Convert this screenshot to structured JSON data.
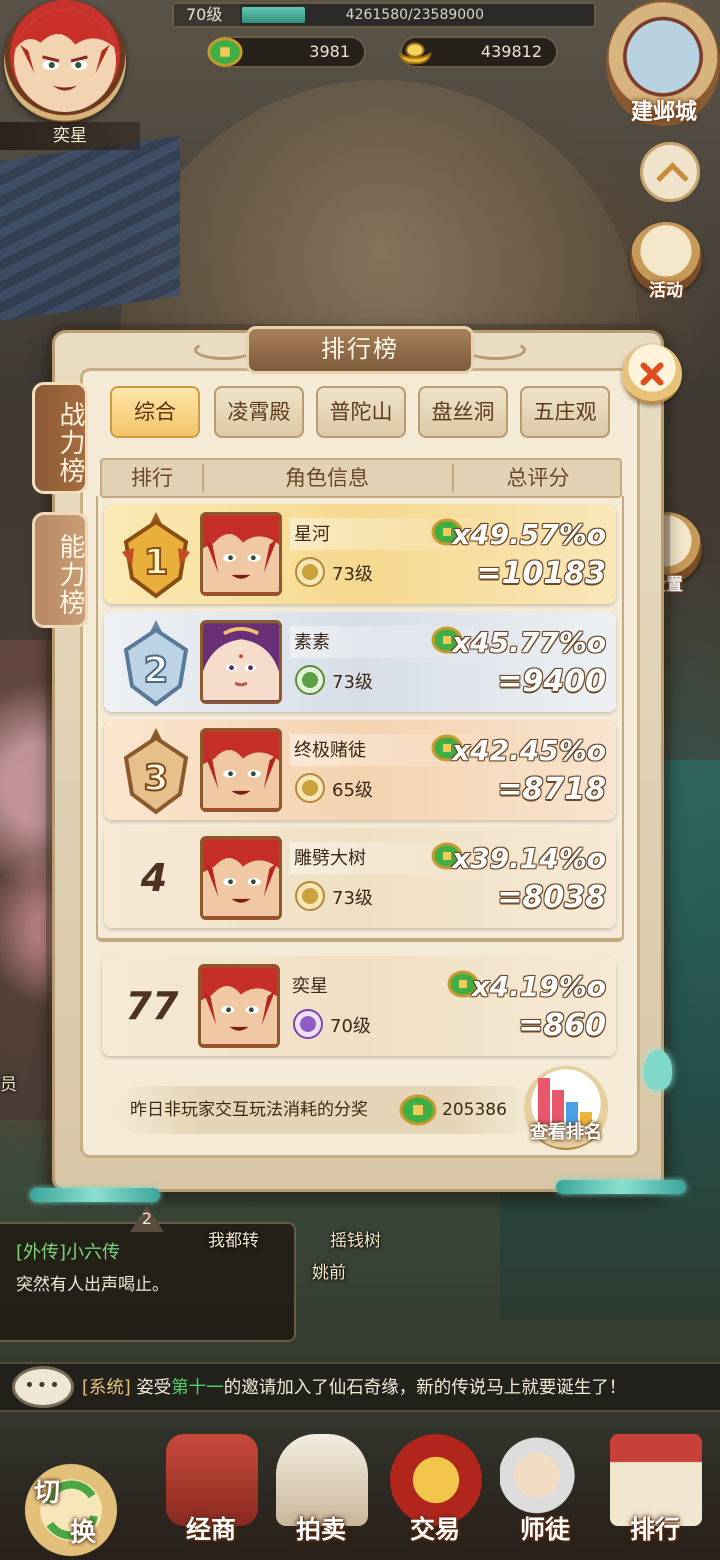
{
  "player": {
    "name": "奕星",
    "level_label": "70级",
    "exp_text": "4261580/23589000",
    "exp_progress": 0.18,
    "copper": "3981",
    "gold": "439812"
  },
  "top_right": {
    "city_label": "建邺城",
    "activity_label": "活动",
    "settings_label": "设置"
  },
  "panel": {
    "title": "排行榜",
    "side_tabs": [
      "战力榜",
      "能力榜"
    ],
    "top_tabs": [
      "综合",
      "凌霄殿",
      "普陀山",
      "盘丝洞",
      "五庄观"
    ],
    "columns": [
      "排行",
      "角色信息",
      "总评分"
    ]
  },
  "rankings": [
    {
      "rank": "1",
      "name": "星河",
      "level": "73级",
      "percent": "x49.57%o",
      "score": "=10183",
      "tier": "gold",
      "school_color": "#c9a23c"
    },
    {
      "rank": "2",
      "name": "素素",
      "level": "73级",
      "percent": "x45.77%o",
      "score": "=9400",
      "tier": "silver",
      "school_color": "#5aa048"
    },
    {
      "rank": "3",
      "name": "终极赌徒",
      "level": "65级",
      "percent": "x42.45%o",
      "score": "=8718",
      "tier": "bronze",
      "school_color": "#c9a23c"
    },
    {
      "rank": "4",
      "name": "雕劈大树",
      "level": "73级",
      "percent": "x39.14%o",
      "score": "=8038",
      "tier": "plain",
      "school_color": "#c9a23c"
    }
  ],
  "self_rank": {
    "rank": "77",
    "name": "奕星",
    "level": "70级",
    "percent": "x4.19%o",
    "score": "=860",
    "school_color": "#8e5cc4"
  },
  "bonus": {
    "label": "昨日非玩家交互玩法消耗的分奖",
    "value": "205386"
  },
  "view_rank_label": "查看排名",
  "quest": {
    "badge": "2",
    "title": "[外传]小六传",
    "desc": "突然有人出声喝止。"
  },
  "scene_labels": {
    "npc_line": "我都转",
    "money_tree": "摇钱树",
    "npc2": "姚前",
    "stray": "员"
  },
  "chat": {
    "prefix": "[系统]",
    "before": "姿受",
    "highlight": "第十一",
    "after": "的邀请加入了仙石奇缘，新的传说马上就要诞生了！"
  },
  "dock": {
    "switch": [
      "切",
      "换"
    ],
    "items": [
      "经商",
      "拍卖",
      "交易",
      "师徒",
      "排行"
    ]
  },
  "colors": {
    "accent_brown": "#8b5a35",
    "gold_tab": "#f2c46a",
    "coin_green": "#3fae45"
  }
}
